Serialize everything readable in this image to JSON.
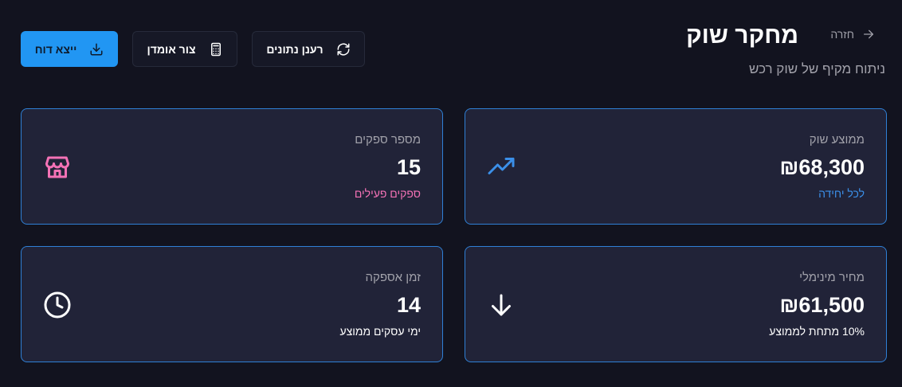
{
  "header": {
    "back_label": "חזרה",
    "title": "מחקר שוק",
    "subtitle": "ניתוח מקיף של שוק רכש"
  },
  "toolbar": {
    "export_label": "ייצא דוח",
    "calculator_label": "צור אומדן",
    "refresh_label": "רענן נתונים"
  },
  "cards": [
    {
      "label": "ממוצע שוק",
      "value": "₪68,300",
      "sub": "לכל יחידה",
      "icon": "trending-up-icon",
      "sub_color": "#3b8fe8"
    },
    {
      "label": "מספר ספקים",
      "value": "15",
      "sub": "ספקים פעילים",
      "icon": "store-icon",
      "sub_color": "#f472b6"
    },
    {
      "label": "מחיר מינימלי",
      "value": "₪61,500",
      "sub": "10% מתחת לממוצע",
      "icon": "arrow-down-icon",
      "sub_color": "#ffffff"
    },
    {
      "label": "זמן אספקה",
      "value": "14",
      "sub": "ימי עסקים ממוצע",
      "icon": "clock-icon",
      "sub_color": "#ffffff"
    }
  ]
}
